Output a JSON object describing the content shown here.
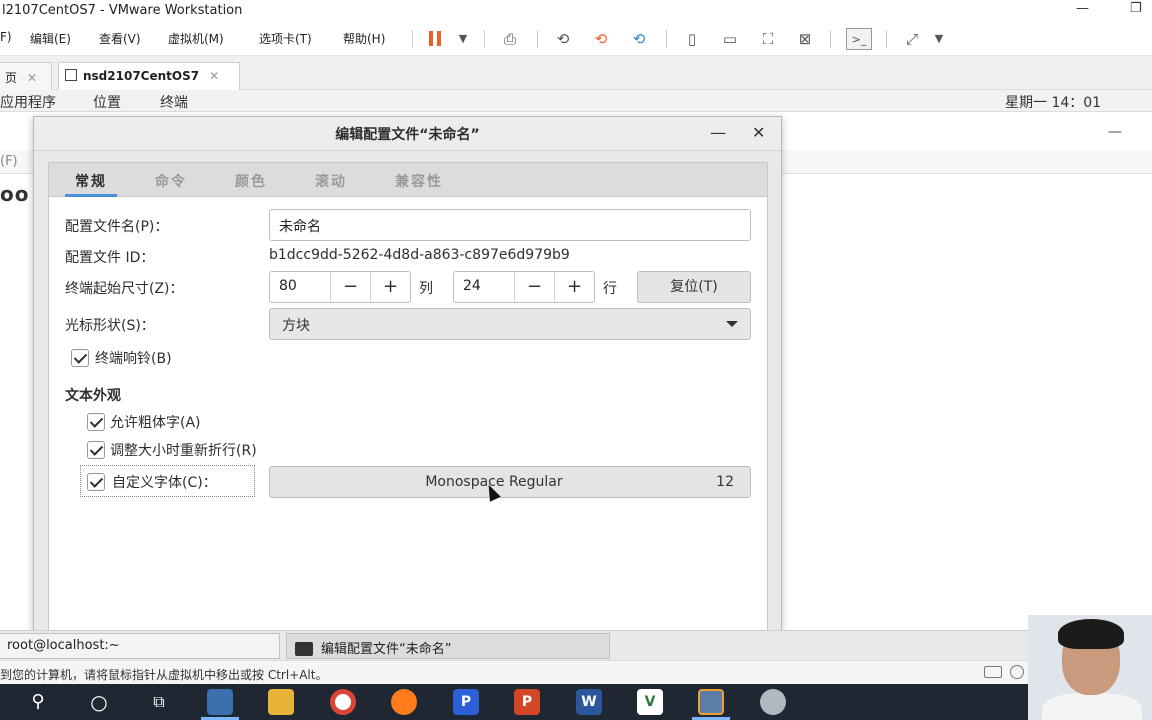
{
  "vmware": {
    "title": "l2107CentOS7 - VMware Workstation",
    "window_controls": {
      "minimize": "—",
      "restore": "❐"
    },
    "menu": [
      "F)",
      "编辑(E)",
      "查看(V)",
      "虚拟机(M)",
      "选项卡(T)",
      "帮助(H)"
    ],
    "tabs": [
      {
        "label": "页",
        "close": "✕"
      },
      {
        "label": "nsd2107CentOS7",
        "close": "✕"
      }
    ],
    "status_text": "到您的计算机，请将鼠标指针从虚拟机中移出或按 Ctrl+Alt。",
    "toolbar_icons": [
      "pause-icon",
      "send-keys-icon",
      "snapshot-icon",
      "revert-snapshot-icon",
      "manage-snapshots-icon",
      "library-icon",
      "console-view-icon",
      "fullscreen-icon",
      "unity-icon",
      "terminal-icon",
      "stretch-icon"
    ]
  },
  "gnome": {
    "apps": "应用程序",
    "places": "位置",
    "terminal": "终端",
    "clock": "星期一 14：01"
  },
  "background_terminal": {
    "menu_fragment": "(F)",
    "text_fragment": "oo",
    "minimize": "—"
  },
  "dialog": {
    "title": "编辑配置文件“未命名”",
    "minimize": "—",
    "close": "✕",
    "tabs": [
      "常规",
      "命令",
      "颜色",
      "滚动",
      "兼容性"
    ],
    "active_tab": "常规",
    "general": {
      "profile_name_label": "配置文件名(P)：",
      "profile_name_value": "未命名",
      "profile_id_label": "配置文件 ID：",
      "profile_id_value": "b1dcc9dd-5262-4d8d-a863-c897e6d979b9",
      "initial_size_label": "终端起始尺寸(Z)：",
      "columns_value": "80",
      "columns_unit": "列",
      "rows_value": "24",
      "rows_unit": "行",
      "minus": "−",
      "plus": "+",
      "reset_button": "复位(T)",
      "cursor_shape_label": "光标形状(S)：",
      "cursor_shape_value": "方块",
      "terminal_bell_label": "终端响铃(B)",
      "terminal_bell_checked": true,
      "text_appearance_heading": "文本外观",
      "allow_bold_label": "允许粗体字(A)",
      "allow_bold_checked": true,
      "rewrap_label": "调整大小时重新折行(R)",
      "rewrap_checked": true,
      "custom_font_label": "自定义字体(C)：",
      "custom_font_checked": true,
      "font_name": "Monospace Regular",
      "font_size": "12"
    }
  },
  "guest_taskbar": {
    "items": [
      {
        "label": "root@localhost:~"
      },
      {
        "label": "编辑配置文件“未命名”"
      }
    ]
  },
  "windows_taskbar": {
    "icons": [
      "search-icon",
      "cortana-icon",
      "task-view-icon",
      "app-icon",
      "file-explorer-icon",
      "chrome-icon",
      "firefox-icon",
      "p-app-icon",
      "powerpoint-icon",
      "word-icon",
      "vmware-icon",
      "workstation-icon",
      "paint-icon"
    ],
    "labels": {
      "p": "P",
      "ppt": "P",
      "word": "W",
      "vm": "V"
    }
  }
}
